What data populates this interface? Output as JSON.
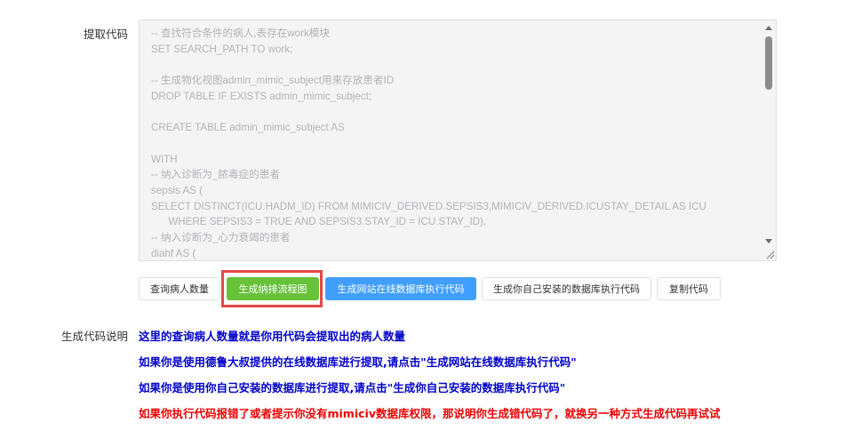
{
  "form": {
    "code_label": "提取代码",
    "explain_label": "生成代码说明"
  },
  "code": {
    "text": "-- 查找符合条件的病人,表存在work模块\nSET SEARCH_PATH TO work;\n\n-- 生成物化视图admin_mimic_subject用来存放患者ID\nDROP TABLE IF EXISTS admin_mimic_subject;\n\nCREATE TABLE admin_mimic_subject AS\n\nWITH\n-- 纳入诊断为_脓毒症的患者\nsepsis AS (\nSELECT DISTINCT(ICU.HADM_ID) FROM MIMICIV_DERIVED.SEPSIS3,MIMICIV_DERIVED.ICUSTAY_DETAIL AS ICU\n      WHERE SEPSIS3 = TRUE AND SEPSIS3.STAY_ID = ICU.STAY_ID),\n-- 纳入诊断为_心力衰竭的患者\ndiahf AS ("
  },
  "buttons": {
    "count": "查询病人数量",
    "flowchart": "生成纳排流程图",
    "online": "生成网站在线数据库执行代码",
    "local": "生成你自己安装的数据库执行代码",
    "copy": "复制代码"
  },
  "notes": [
    {
      "text": "这里的查询病人数量就是你用代码会提取出的病人数量",
      "color": "#0000cc"
    },
    {
      "text": "如果你是使用德鲁大叔提供的在线数据库进行提取,请点击\"生成网站在线数据库执行代码\"",
      "color": "#0000cc"
    },
    {
      "text": "如果你是使用你自己安装的数据库进行提取,请点击\"生成你自己安装的数据库执行代码\"",
      "color": "#0000cc"
    },
    {
      "text": "如果你执行代码报错了或者提示你没有mimiciv数据库权限，那说明你生成错代码了，就换另一种方式生成代码再试试",
      "color": "#ee0000"
    }
  ],
  "colors": {
    "green_button": "#67c23a",
    "blue_button": "#409eff",
    "highlight_border": "#e34848"
  }
}
